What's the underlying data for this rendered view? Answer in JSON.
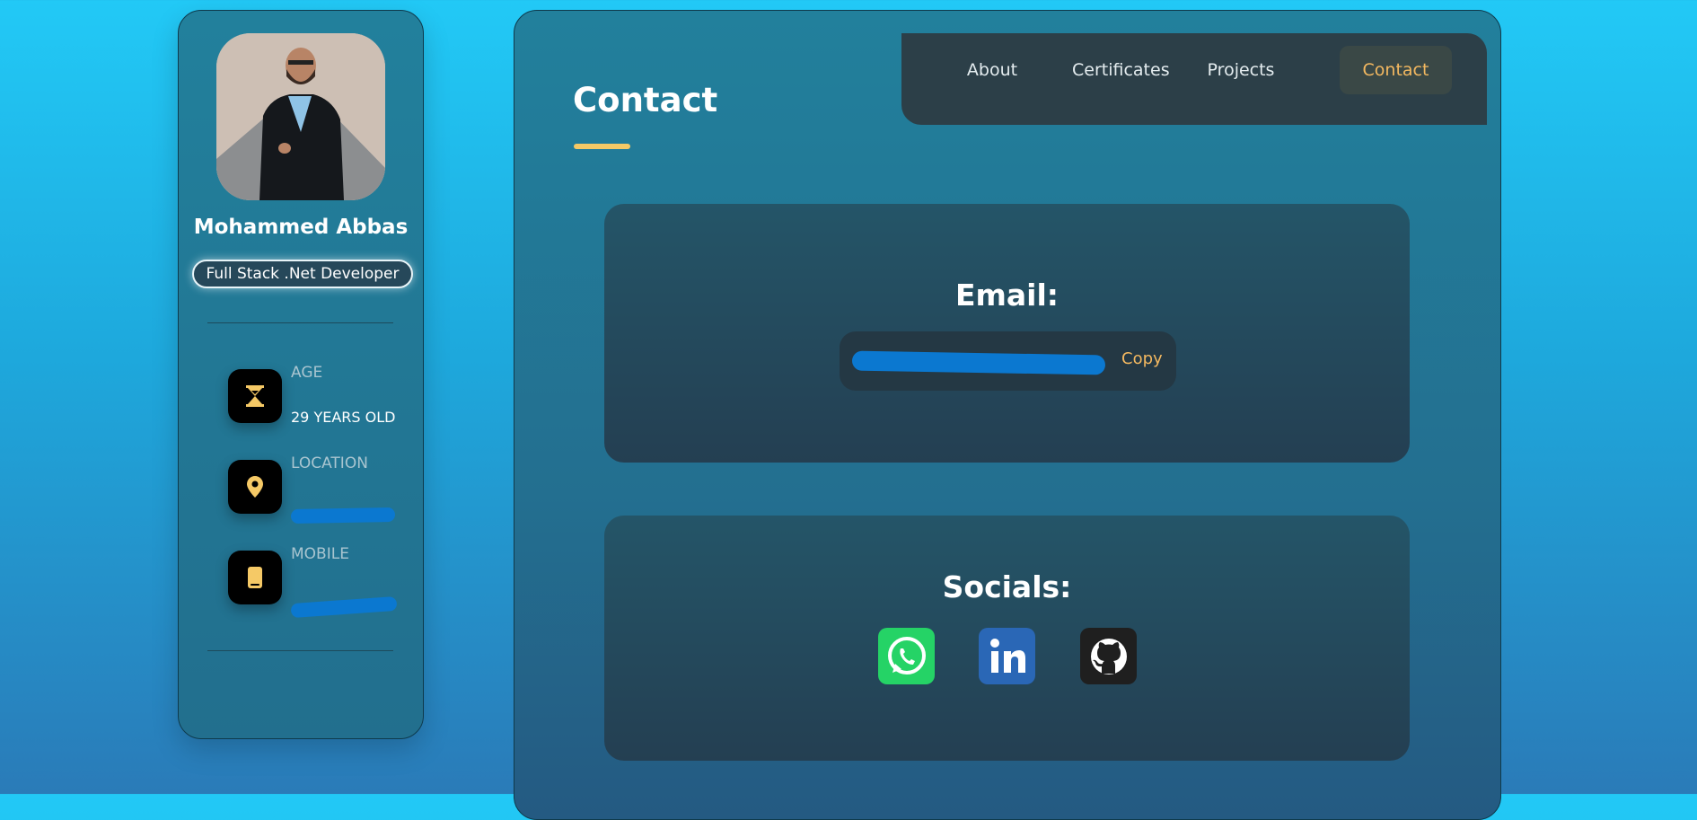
{
  "profile": {
    "name": "Mohammed Abbas",
    "role": "Full Stack .Net Developer",
    "info": [
      {
        "icon": "hourglass-icon",
        "label": "AGE",
        "value": "29 YEARS OLD"
      },
      {
        "icon": "location-pin-icon",
        "label": "LOCATION",
        "value": ""
      },
      {
        "icon": "mobile-phone-icon",
        "label": "MOBILE",
        "value": ""
      }
    ]
  },
  "page": {
    "title": "Contact"
  },
  "nav": {
    "items": [
      "About",
      "Certificates",
      "Projects",
      "Contact"
    ],
    "active": "Contact"
  },
  "email_card": {
    "heading": "Email:",
    "copy_label": "Copy"
  },
  "socials_card": {
    "heading": "Socials:",
    "links": [
      {
        "icon": "whatsapp-icon"
      },
      {
        "icon": "linkedin-icon"
      },
      {
        "icon": "github-icon"
      }
    ]
  },
  "colors": {
    "accent": "#f3b860",
    "underline": "#f5c966",
    "whatsapp": "#25d366",
    "linkedin": "#2a67b6",
    "github": "#1f1f1f"
  }
}
